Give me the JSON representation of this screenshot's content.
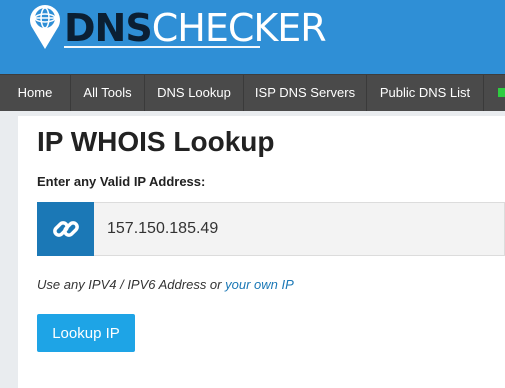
{
  "header": {
    "logo": {
      "dns": "DNS",
      "checker": "CHECKER"
    }
  },
  "nav": {
    "items": [
      {
        "label": "Home"
      },
      {
        "label": "All Tools"
      },
      {
        "label": "DNS Lookup"
      },
      {
        "label": "ISP DNS Servers"
      },
      {
        "label": "Public DNS List"
      }
    ]
  },
  "page": {
    "title": "IP WHOIS Lookup",
    "ip_label": "Enter any Valid IP Address:",
    "ip_value": "157.150.185.49",
    "hint_prefix": "Use any IPV4 / IPV6 Address or ",
    "hint_link": "your own IP",
    "button_label": "Lookup IP"
  },
  "colors": {
    "header_bg": "#2f8fd6",
    "nav_bg": "#4a4a4a",
    "addon_bg": "#1b78b6",
    "button_bg": "#1ea4e6",
    "link": "#1b78b6"
  },
  "icons": [
    "globe-pin-icon",
    "link-icon"
  ]
}
